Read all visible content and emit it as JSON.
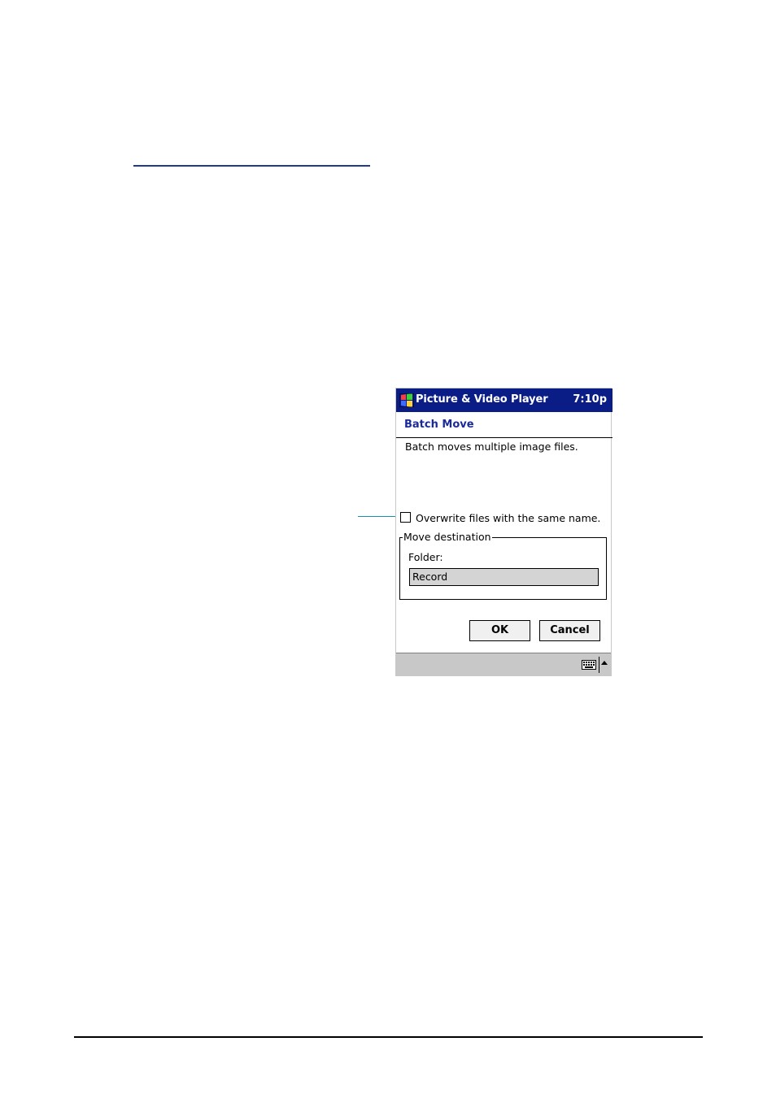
{
  "app": {
    "title": "Picture & Video Player",
    "clock": "7:10p"
  },
  "dialog": {
    "title": "Batch Move",
    "description": "Batch moves multiple image files.",
    "overwrite_checkbox": {
      "label": "Overwrite files with the same name.",
      "checked": false
    },
    "group": {
      "legend": "Move destination",
      "folder_label": "Folder:",
      "folder_value": "Record"
    },
    "buttons": {
      "ok": "OK",
      "cancel": "Cancel"
    }
  },
  "menubar": {
    "icons": [
      "keyboard-icon",
      "sip-arrow-up-icon"
    ]
  },
  "colors": {
    "titlebar_bg": "#0a1d87",
    "dialog_title": "#1a2a9a",
    "menubar_bg": "#c8c8c8",
    "field_bg": "#d4d4d4",
    "callout": "#1a8fb0"
  }
}
